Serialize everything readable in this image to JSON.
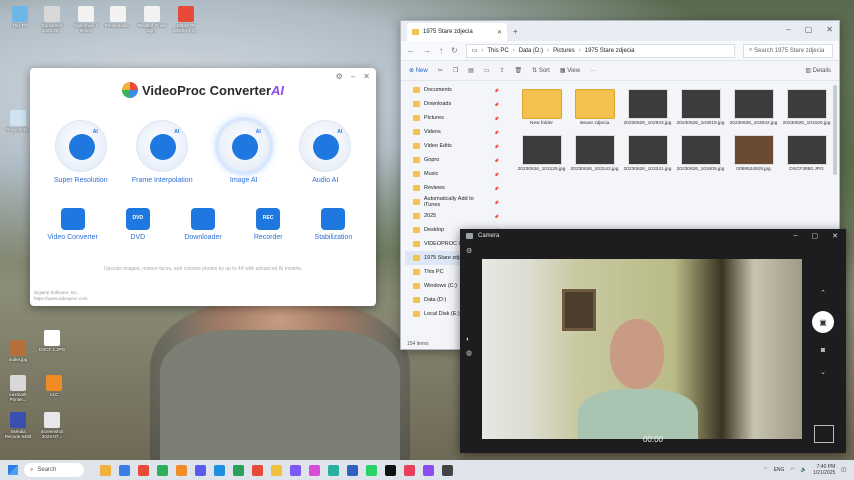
{
  "desktop": {
    "icons": [
      {
        "label": "This PC",
        "color": "#6fb6e8"
      },
      {
        "label": "Converted 2023-06...",
        "color": "#d8d8d8"
      },
      {
        "label": "Slideshow 4 letters",
        "color": "#f2f2f2"
      },
      {
        "label": "Presentatio...",
        "color": "#f2f2f2"
      },
      {
        "label": "Related Flows Bgi...",
        "color": "#f2f2f2"
      },
      {
        "label": "ENSKYP 1050M-1 C...",
        "color": "#e84a3a"
      },
      {
        "label": "Recycle Bin",
        "color": "#cfe3f2"
      },
      {
        "label": "outlet.jpg",
        "color": "#b56f3a"
      },
      {
        "label": "DSCF 1.JPG",
        "color": "#ffffff"
      },
      {
        "label": "Lexmark Printer...",
        "color": "#d8d8d8"
      },
      {
        "label": "VLC",
        "color": "#f08a24"
      },
      {
        "label": "XMedia Recode 64bit",
        "color": "#3a4fb0"
      },
      {
        "label": "Screenshot 2023-07...",
        "color": "#e8e8e8"
      }
    ]
  },
  "videoproc": {
    "title_main": "VideoProc Converter",
    "title_ai": "AI",
    "big_tools": [
      {
        "label": "Super Resolution",
        "badge": "AI"
      },
      {
        "label": "Frame Interpolation",
        "badge": "AI"
      },
      {
        "label": "Image AI",
        "badge": "AI"
      },
      {
        "label": "Audio AI",
        "badge": "AI"
      }
    ],
    "small_tools": [
      {
        "label": "Video Converter",
        "icon_text": ""
      },
      {
        "label": "DVD",
        "icon_text": "DVD"
      },
      {
        "label": "Downloader",
        "icon_text": ""
      },
      {
        "label": "Recorder",
        "icon_text": "REC"
      },
      {
        "label": "Stabilization",
        "icon_text": ""
      }
    ],
    "tagline": "Upscale images, restore faces, and colorize photos by up to 4X with advanced AI models.",
    "company_line1": "Digiarty Software, Inc.",
    "company_line2": "https://www.videoproc.com"
  },
  "explorer": {
    "tab_title": "1975 Stare zdjecia",
    "breadcrumb": [
      "This PC",
      "Data (D:)",
      "Pictures",
      "1975 Stare zdjecia"
    ],
    "search_placeholder": "Search 1975 Stare zdjecia",
    "toolbar": {
      "new": "New",
      "sort": "Sort",
      "view": "View",
      "more": "···",
      "details": "Details"
    },
    "nav_items": [
      {
        "label": "Documents",
        "selected": false
      },
      {
        "label": "Downloads",
        "selected": false
      },
      {
        "label": "Pictures",
        "selected": false
      },
      {
        "label": "Videos",
        "selected": false
      },
      {
        "label": "Video Edits",
        "selected": false
      },
      {
        "label": "Gopro",
        "selected": false
      },
      {
        "label": "Music",
        "selected": false
      },
      {
        "label": "Reviews",
        "selected": false
      },
      {
        "label": "Automatically Add to iTunes",
        "selected": false
      },
      {
        "label": "2025",
        "selected": false
      },
      {
        "label": "Desktop",
        "selected": false
      },
      {
        "label": "VIDEOPROC Co...",
        "selected": false
      },
      {
        "label": "1975 Stare zdjeci...",
        "selected": true
      },
      {
        "label": "This PC",
        "selected": false
      },
      {
        "label": "Windows (C:)",
        "selected": false
      },
      {
        "label": "Data (D:)",
        "selected": false
      },
      {
        "label": "Local Disk (E:)",
        "selected": false
      }
    ],
    "files": [
      {
        "name": "New folder",
        "kind": "folder"
      },
      {
        "name": "steare zdjecia",
        "kind": "folder"
      },
      {
        "name": "20230626_102933.jpg",
        "kind": "photo"
      },
      {
        "name": "20230626_103019.jpg",
        "kind": "photo"
      },
      {
        "name": "20230626_103042.jpg",
        "kind": "photo"
      },
      {
        "name": "20230626_103100.jpg",
        "kind": "photo"
      },
      {
        "name": "20230626_103125.jpg",
        "kind": "photo"
      },
      {
        "name": "20230626_103143.jpg",
        "kind": "photo"
      },
      {
        "name": "20230626_103241.jpg",
        "kind": "photo"
      },
      {
        "name": "20230626_103409.jpg",
        "kind": "photo"
      },
      {
        "name": "0059524919.jpg",
        "kind": "sepia"
      },
      {
        "name": "DSCF3880.JPG",
        "kind": "photo"
      }
    ],
    "status": "154 items"
  },
  "camera": {
    "title": "Camera",
    "timer": "00:00"
  },
  "taskbar": {
    "search_label": "Search",
    "apps": [
      "#f0b23a",
      "#3b7de8",
      "#e84a3a",
      "#2fae5a",
      "#f28c28",
      "#5a5aef",
      "#1f8fe0",
      "#28a05a",
      "#e84a3a",
      "#f0c040",
      "#7a5af0",
      "#d84ad8",
      "#28b0a0",
      "#3060c0",
      "#25d366",
      "#111111",
      "#e8405a",
      "#8a4cf0",
      "#444444"
    ],
    "lang": "ENG",
    "time": "7:40 PM",
    "date": "1/21/2025"
  }
}
